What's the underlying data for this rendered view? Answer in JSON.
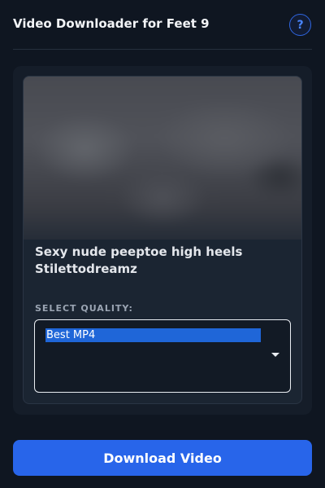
{
  "header": {
    "title": "Video Downloader for Feet 9",
    "help_label": "?"
  },
  "video": {
    "title": "Sexy nude peeptoe high heels Stilettodreamz"
  },
  "quality": {
    "label": "SELECT QUALITY:",
    "selected": "Best MP4"
  },
  "actions": {
    "download_label": "Download Video"
  },
  "colors": {
    "accent": "#2865ea",
    "background": "#0f1621",
    "card": "#1b2532"
  }
}
